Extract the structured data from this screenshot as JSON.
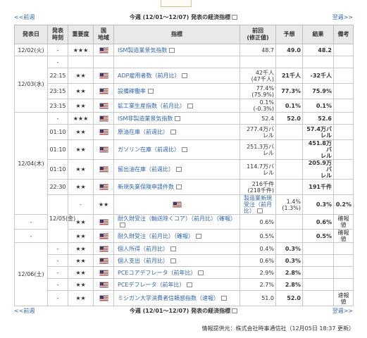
{
  "nav": {
    "prev": "<<前週",
    "title": "今週 (12/01〜12/07) 発表の経済指標",
    "next": "翌週>>"
  },
  "headers": [
    "発表日",
    "発表\n時刻",
    "重要度",
    "国\n地域",
    "指標",
    "前回\n(修正値)",
    "予想",
    "結果",
    "備考"
  ],
  "rows": [
    {
      "date": "12/02(火)",
      "span": 1,
      "time": "-",
      "stars": "★★★",
      "ind": "ISM製造業景気指数",
      "prev": "48.7",
      "fc": "49.0",
      "res": "48.2",
      "note": ""
    },
    {
      "date": "12/03(水)",
      "span": 4,
      "time": "-",
      "stars": "",
      "ind": "",
      "prev": "",
      "fc": "",
      "res": "",
      "note": ""
    },
    {
      "time": "22:15",
      "stars": "★★",
      "ind": "ADP雇用者数（前月比）",
      "prev": "42千人\n(47千人)",
      "fc": "21千人",
      "res": "-32千人",
      "note": ""
    },
    {
      "time": "23:15",
      "stars": "★★",
      "ind": "設備稼働率",
      "prev": "77.4%\n(75.9%)",
      "fc": "77.3%",
      "res": "75.9%",
      "note": ""
    },
    {
      "time": "23:15",
      "stars": "★★",
      "ind": "鉱工業生産指数（前月比）",
      "prev": "0.1%\n(-0.3%)",
      "fc": "0.1%",
      "res": "0.1%",
      "note": ""
    },
    {
      "date": "12/04(木)",
      "span": 6,
      "time": "-",
      "stars": "★★★",
      "ind": "ISM非製造業景気指数",
      "prev": "52.4",
      "fc": "52.0",
      "res": "52.6",
      "note": ""
    },
    {
      "time": "01:10",
      "stars": "★★",
      "ind": "原油在庫（前週比）",
      "prev": "277.4万バ\nレル",
      "fc": "",
      "res": "57.4万バ\nレル",
      "note": ""
    },
    {
      "time": "01:10",
      "stars": "★★",
      "ind": "ガソリン在庫（前週比）",
      "prev": "251.3万バ\nレル",
      "fc": "",
      "res": "451.8万バ\nレル",
      "note": ""
    },
    {
      "time": "01:10",
      "stars": "★★",
      "ind": "留出油在庫（前週比）",
      "prev": "114.7万バ\nレル",
      "fc": "",
      "res": "205.9万バ\nレル",
      "note": ""
    },
    {
      "time": "22:30",
      "stars": "★★",
      "ind": "新規失業保険申請件数",
      "prev": "216千件\n(218千件)",
      "fc": "",
      "res": "191千件",
      "note": ""
    },
    {
      "date": "12/05(金)",
      "span": 3,
      "time": "-",
      "stars": "★★",
      "ind": "製造業新規受注（前月比）",
      "prev": "1.4%\n(1.3%)",
      "fc": "0.3%",
      "res": "0.2%",
      "note": ""
    },
    {
      "time": "-",
      "stars": "★★",
      "ind": "耐久財受注（輸送除くコア）（前月比）（確報）",
      "prev": "0.6%",
      "fc": "",
      "res": "0.6%",
      "note": "確報値"
    },
    {
      "time": "-",
      "stars": "★★",
      "ind": "耐久財受注（前月比）（確報）",
      "prev": "0.5%",
      "fc": "",
      "res": "0.5%",
      "note": "確報値"
    },
    {
      "date": "12/06(土)",
      "span": 6,
      "time": "-",
      "stars": "★★",
      "ind": "個人所得（前月比）",
      "prev": "0.4%",
      "fc": "0.3%",
      "res": "",
      "note": ""
    },
    {
      "time": "-",
      "stars": "★★",
      "ind": "個人支出（前月比）",
      "prev": "0.6%",
      "fc": "0.3%",
      "res": "",
      "note": ""
    },
    {
      "time": "-",
      "stars": "★★",
      "ind": "PCEコアデフレータ（前年比）",
      "prev": "2.9%",
      "fc": "2.8%",
      "res": "",
      "note": ""
    },
    {
      "time": "-",
      "stars": "★★",
      "ind": "PCEデフレータ（前年比）",
      "prev": "2.7%",
      "fc": "2.8%",
      "res": "",
      "note": ""
    },
    {
      "time": "-",
      "stars": "★★",
      "ind": "ミシガン大学消費者信頼感指数（速報）",
      "prev": "51.0",
      "fc": "52.0",
      "res": "",
      "note": "速報値"
    }
  ],
  "footer": "情報提供元：株式会社時事通信社（12月05日 18:37 更新）"
}
